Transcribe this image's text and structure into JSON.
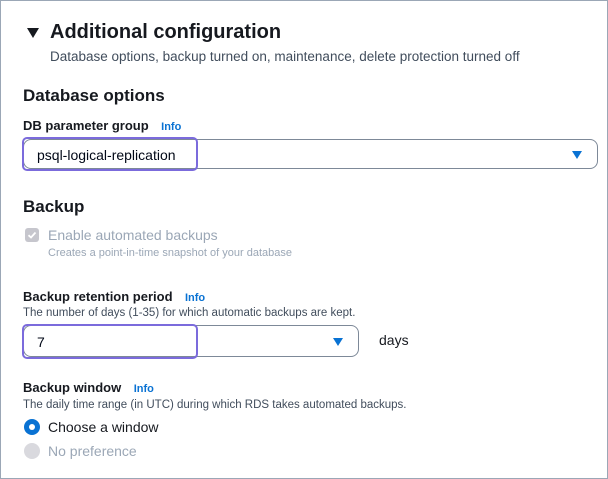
{
  "additional_config": {
    "title": "Additional configuration",
    "description": "Database options, backup turned on, maintenance, delete protection turned off"
  },
  "database_options": {
    "heading": "Database options",
    "param_group_label": "DB parameter group",
    "info": "Info",
    "param_group_value": "psql-logical-replication"
  },
  "backup": {
    "heading": "Backup",
    "auto_backups_label": "Enable automated backups",
    "auto_backups_desc": "Creates a point-in-time snapshot of your database",
    "auto_backups_checked": true,
    "retention_label": "Backup retention period",
    "retention_info": "Info",
    "retention_desc": "The number of days (1-35) for which automatic backups are kept.",
    "retention_value": "7",
    "retention_unit": "days",
    "window_label": "Backup window",
    "window_info": "Info",
    "window_desc": "The daily time range (in UTC) during which RDS takes automated backups.",
    "window_options": [
      {
        "label": "Choose a window",
        "selected": true
      },
      {
        "label": "No preference",
        "selected": false
      }
    ]
  },
  "colors": {
    "accent": "#0972d3",
    "highlight": "#7b6bdc",
    "disabled": "#9ba7b6"
  }
}
